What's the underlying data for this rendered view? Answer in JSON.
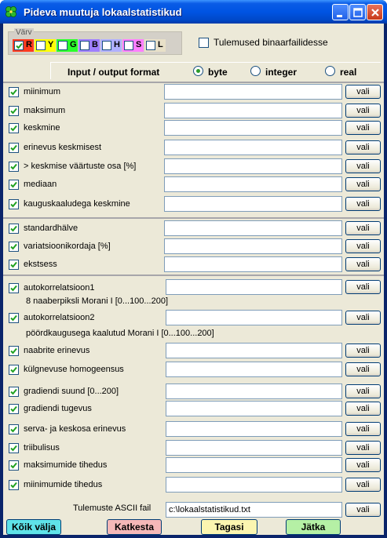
{
  "window": {
    "title": "Pideva muutuja lokaalstatistikud"
  },
  "colors": {
    "legend": "Värv",
    "items": [
      {
        "letter": "R",
        "swatch": "#ff3b1f",
        "checked": true
      },
      {
        "letter": "Y",
        "swatch": "#ffff00",
        "checked": false
      },
      {
        "letter": "G",
        "swatch": "#2aff2a",
        "checked": false
      },
      {
        "letter": "B",
        "swatch": "#9f7fff",
        "checked": false
      },
      {
        "letter": "H",
        "swatch": "#b0b0ff",
        "checked": false
      },
      {
        "letter": "S",
        "swatch": "#ff7fff",
        "checked": false
      },
      {
        "letter": "L",
        "swatch": "#e8e0c8",
        "checked": false
      }
    ]
  },
  "binary_output": {
    "label": "Tulemused binaarfailidesse",
    "checked": false
  },
  "format": {
    "label": "Input / output format",
    "options": [
      {
        "label": "byte",
        "selected": true
      },
      {
        "label": "integer",
        "selected": false
      },
      {
        "label": "real",
        "selected": false
      }
    ]
  },
  "choose_label": "vali",
  "stats": [
    {
      "label": "miinimum",
      "checked": true,
      "value": ""
    },
    {
      "label": "maksimum",
      "checked": true,
      "value": ""
    },
    {
      "label": "keskmine",
      "checked": true,
      "value": ""
    },
    {
      "label": "erinevus keskmisest",
      "checked": true,
      "value": ""
    },
    {
      "label": "> keskmise väärtuste osa [%]",
      "checked": true,
      "value": ""
    },
    {
      "label": "mediaan",
      "checked": true,
      "value": ""
    },
    {
      "label": "kauguskaaludega keskmine",
      "checked": true,
      "value": ""
    }
  ],
  "dispersion": [
    {
      "label": "standardhälve",
      "checked": true,
      "value": ""
    },
    {
      "label": "variatsioonikordaja [%]",
      "checked": true,
      "value": ""
    },
    {
      "label": "ekstsess",
      "checked": true,
      "value": ""
    }
  ],
  "texture": [
    {
      "label": "autokorrelatsioon1",
      "sub": "8 naaberpiksli Morani I [0...100...200]",
      "checked": true,
      "value": ""
    },
    {
      "label": "autokorrelatsioon2",
      "sub": "pöördkaugusega kaalutud Morani I [0...100...200]",
      "checked": true,
      "value": ""
    },
    {
      "label": "naabrite erinevus",
      "checked": true,
      "value": ""
    },
    {
      "label": "külgnevuse homogeensus",
      "checked": true,
      "value": ""
    },
    {
      "label": "gradiendi suund [0...200]",
      "checked": true,
      "value": ""
    },
    {
      "label": "gradiendi tugevus",
      "checked": true,
      "value": ""
    },
    {
      "label": "serva- ja keskosa erinevus",
      "checked": true,
      "value": ""
    },
    {
      "label": "triibulisus",
      "checked": true,
      "value": ""
    },
    {
      "label": "maksimumide tihedus",
      "checked": true,
      "value": ""
    },
    {
      "label": "miinimumide tihedus",
      "checked": true,
      "value": ""
    }
  ],
  "ascii": {
    "label": "Tulemuste ASCII fail",
    "value": "c:\\lokaalstatistikud.txt"
  },
  "buttons": {
    "all": "Kõik välja",
    "cancel": "Katkesta",
    "back": "Tagasi",
    "next": "Jätka"
  }
}
